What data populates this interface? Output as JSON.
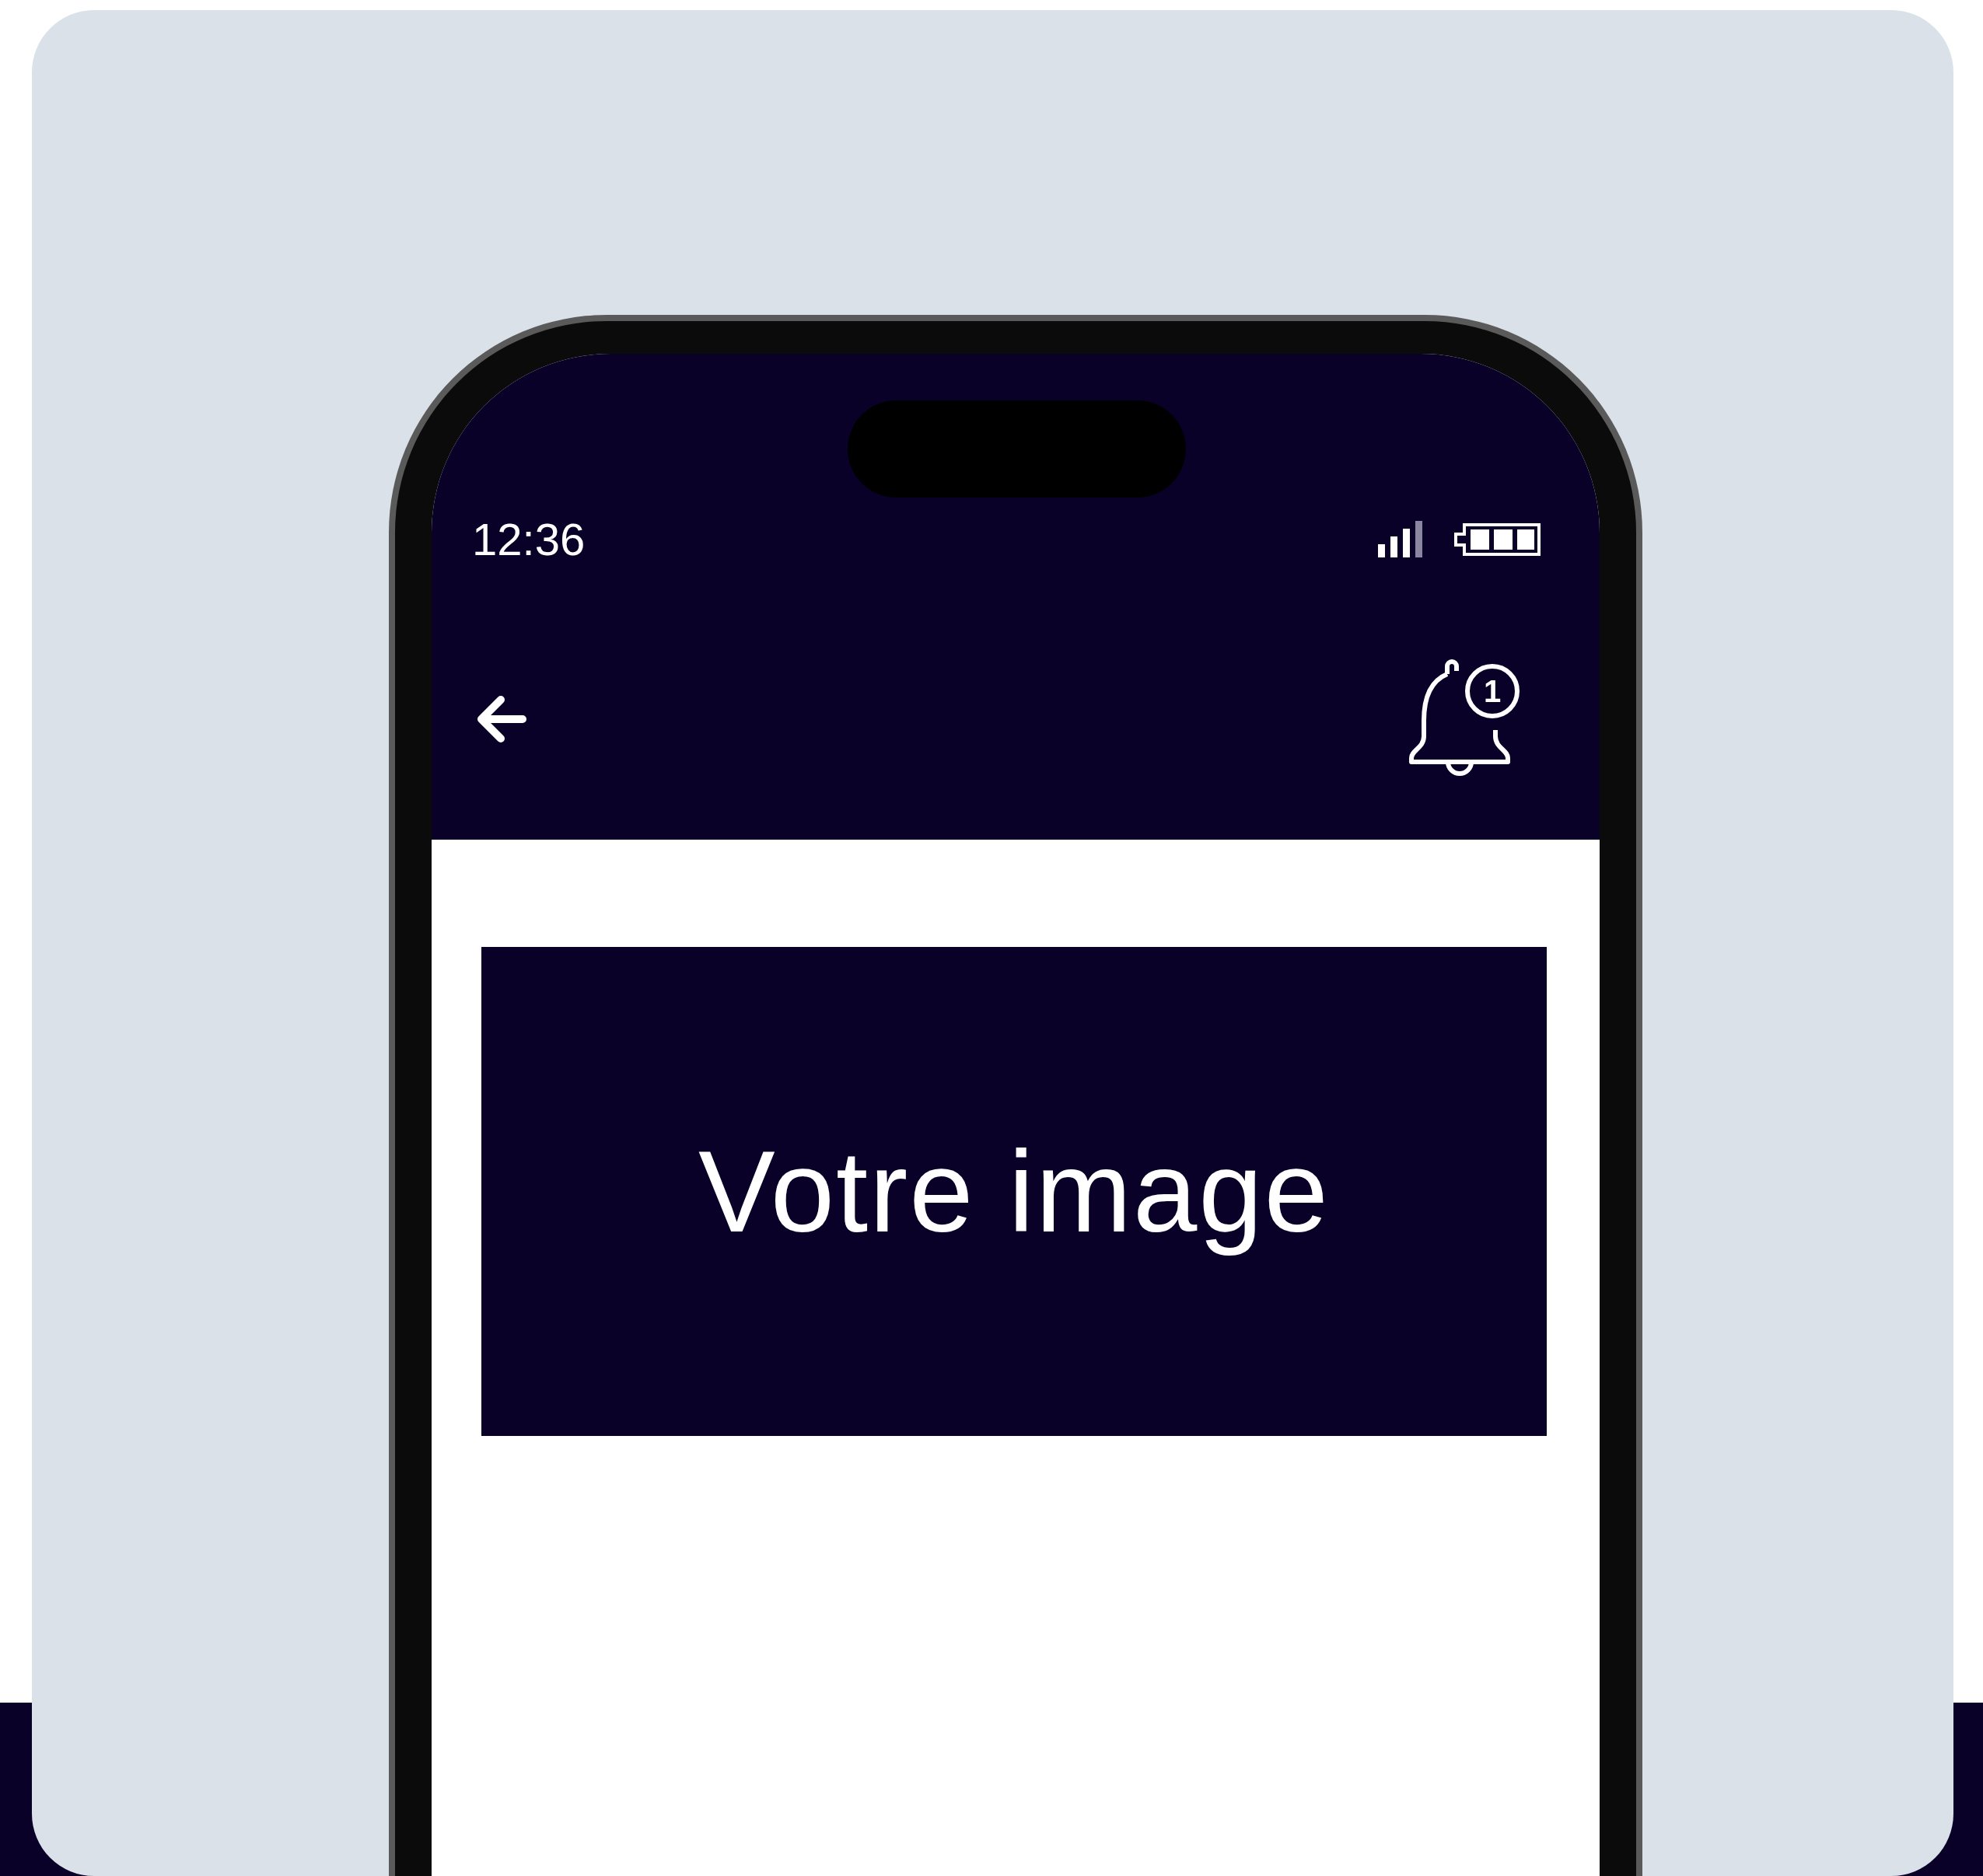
{
  "status_bar": {
    "time": "12:36"
  },
  "toolbar": {
    "notification_count": "1"
  },
  "banner": {
    "title": "Votre image"
  }
}
